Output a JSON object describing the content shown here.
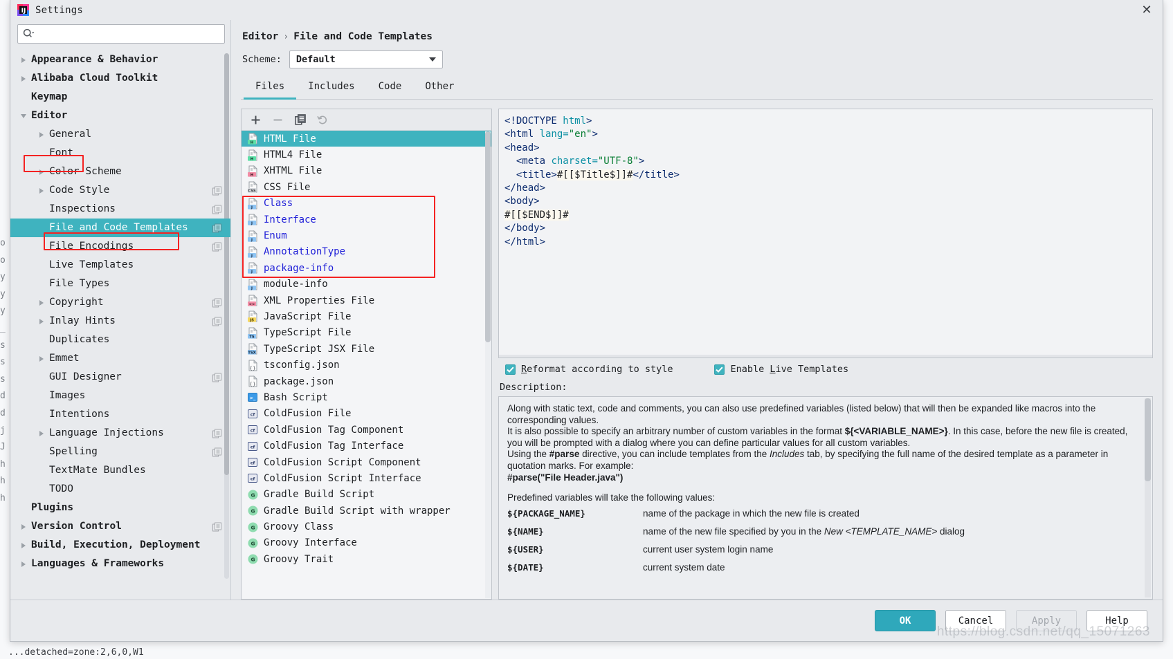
{
  "window": {
    "title": "Settings",
    "close_label": "✕",
    "app_icon": "intellij-idea-icon"
  },
  "search": {
    "placeholder": "",
    "value": "",
    "icon": "search-icon"
  },
  "sidebar": {
    "items": [
      {
        "label": "Appearance & Behavior",
        "indent": 0,
        "arrow": "right",
        "bold": true,
        "badge": false,
        "selected": false
      },
      {
        "label": "Alibaba Cloud Toolkit",
        "indent": 0,
        "arrow": "right",
        "bold": true,
        "badge": false,
        "selected": false
      },
      {
        "label": "Keymap",
        "indent": 0,
        "arrow": "none",
        "bold": true,
        "badge": false,
        "selected": false
      },
      {
        "label": "Editor",
        "indent": 0,
        "arrow": "down",
        "bold": true,
        "badge": false,
        "selected": false
      },
      {
        "label": "General",
        "indent": 1,
        "arrow": "right",
        "bold": false,
        "badge": false,
        "selected": false
      },
      {
        "label": "Font",
        "indent": 1,
        "arrow": "none",
        "bold": false,
        "badge": false,
        "selected": false
      },
      {
        "label": "Color Scheme",
        "indent": 1,
        "arrow": "right",
        "bold": false,
        "badge": false,
        "selected": false
      },
      {
        "label": "Code Style",
        "indent": 1,
        "arrow": "right",
        "bold": false,
        "badge": true,
        "selected": false
      },
      {
        "label": "Inspections",
        "indent": 1,
        "arrow": "none",
        "bold": false,
        "badge": true,
        "selected": false
      },
      {
        "label": "File and Code Templates",
        "indent": 1,
        "arrow": "none",
        "bold": false,
        "badge": true,
        "selected": true
      },
      {
        "label": "File Encodings",
        "indent": 1,
        "arrow": "none",
        "bold": false,
        "badge": true,
        "selected": false
      },
      {
        "label": "Live Templates",
        "indent": 1,
        "arrow": "none",
        "bold": false,
        "badge": false,
        "selected": false
      },
      {
        "label": "File Types",
        "indent": 1,
        "arrow": "none",
        "bold": false,
        "badge": false,
        "selected": false
      },
      {
        "label": "Copyright",
        "indent": 1,
        "arrow": "right",
        "bold": false,
        "badge": true,
        "selected": false
      },
      {
        "label": "Inlay Hints",
        "indent": 1,
        "arrow": "right",
        "bold": false,
        "badge": true,
        "selected": false
      },
      {
        "label": "Duplicates",
        "indent": 1,
        "arrow": "none",
        "bold": false,
        "badge": false,
        "selected": false
      },
      {
        "label": "Emmet",
        "indent": 1,
        "arrow": "right",
        "bold": false,
        "badge": false,
        "selected": false
      },
      {
        "label": "GUI Designer",
        "indent": 1,
        "arrow": "none",
        "bold": false,
        "badge": true,
        "selected": false
      },
      {
        "label": "Images",
        "indent": 1,
        "arrow": "none",
        "bold": false,
        "badge": false,
        "selected": false
      },
      {
        "label": "Intentions",
        "indent": 1,
        "arrow": "none",
        "bold": false,
        "badge": false,
        "selected": false
      },
      {
        "label": "Language Injections",
        "indent": 1,
        "arrow": "right",
        "bold": false,
        "badge": true,
        "selected": false
      },
      {
        "label": "Spelling",
        "indent": 1,
        "arrow": "none",
        "bold": false,
        "badge": true,
        "selected": false
      },
      {
        "label": "TextMate Bundles",
        "indent": 1,
        "arrow": "none",
        "bold": false,
        "badge": false,
        "selected": false
      },
      {
        "label": "TODO",
        "indent": 1,
        "arrow": "none",
        "bold": false,
        "badge": false,
        "selected": false
      },
      {
        "label": "Plugins",
        "indent": 0,
        "arrow": "none",
        "bold": true,
        "badge": false,
        "selected": false
      },
      {
        "label": "Version Control",
        "indent": 0,
        "arrow": "right",
        "bold": true,
        "badge": true,
        "selected": false
      },
      {
        "label": "Build, Execution, Deployment",
        "indent": 0,
        "arrow": "right",
        "bold": true,
        "badge": false,
        "selected": false
      },
      {
        "label": "Languages & Frameworks",
        "indent": 0,
        "arrow": "right",
        "bold": true,
        "badge": false,
        "selected": false
      }
    ]
  },
  "breadcrumb": {
    "parent": "Editor",
    "separator": "›",
    "current": "File and Code Templates"
  },
  "scheme": {
    "label": "Scheme:",
    "value": "Default"
  },
  "tabs": [
    {
      "label": "Files",
      "active": true
    },
    {
      "label": "Includes",
      "active": false
    },
    {
      "label": "Code",
      "active": false
    },
    {
      "label": "Other",
      "active": false
    }
  ],
  "list_toolbar": [
    {
      "name": "add-template-button",
      "glyph": "plus",
      "enabled": true
    },
    {
      "name": "remove-template-button",
      "glyph": "minus",
      "enabled": false
    },
    {
      "name": "copy-template-button",
      "glyph": "copy",
      "enabled": true
    },
    {
      "name": "reset-template-button",
      "glyph": "undo",
      "enabled": false
    }
  ],
  "file_templates": [
    {
      "label": "HTML File",
      "icon": "html-file-icon",
      "selected": true,
      "java": false
    },
    {
      "label": "HTML4 File",
      "icon": "html-file-icon",
      "selected": false,
      "java": false
    },
    {
      "label": "XHTML File",
      "icon": "xhtml-file-icon",
      "selected": false,
      "java": false
    },
    {
      "label": "CSS File",
      "icon": "css-file-icon",
      "selected": false,
      "java": false
    },
    {
      "label": "Class",
      "icon": "java-file-icon",
      "selected": false,
      "java": true
    },
    {
      "label": "Interface",
      "icon": "java-file-icon",
      "selected": false,
      "java": true
    },
    {
      "label": "Enum",
      "icon": "java-file-icon",
      "selected": false,
      "java": true
    },
    {
      "label": "AnnotationType",
      "icon": "java-file-icon",
      "selected": false,
      "java": true
    },
    {
      "label": "package-info",
      "icon": "java-file-icon",
      "selected": false,
      "java": true
    },
    {
      "label": "module-info",
      "icon": "java-file-icon",
      "selected": false,
      "java": false
    },
    {
      "label": "XML Properties File",
      "icon": "xml-file-icon",
      "selected": false,
      "java": false
    },
    {
      "label": "JavaScript File",
      "icon": "javascript-file-icon",
      "selected": false,
      "java": false
    },
    {
      "label": "TypeScript File",
      "icon": "typescript-file-icon",
      "selected": false,
      "java": false
    },
    {
      "label": "TypeScript JSX File",
      "icon": "tsx-file-icon",
      "selected": false,
      "java": false
    },
    {
      "label": "tsconfig.json",
      "icon": "json-file-icon",
      "selected": false,
      "java": false
    },
    {
      "label": "package.json",
      "icon": "json-file-icon",
      "selected": false,
      "java": false
    },
    {
      "label": "Bash Script",
      "icon": "bash-script-icon",
      "selected": false,
      "java": false
    },
    {
      "label": "ColdFusion File",
      "icon": "coldfusion-icon",
      "selected": false,
      "java": false
    },
    {
      "label": "ColdFusion Tag Component",
      "icon": "coldfusion-icon",
      "selected": false,
      "java": false
    },
    {
      "label": "ColdFusion Tag Interface",
      "icon": "coldfusion-icon",
      "selected": false,
      "java": false
    },
    {
      "label": "ColdFusion Script Component",
      "icon": "coldfusion-icon",
      "selected": false,
      "java": false
    },
    {
      "label": "ColdFusion Script Interface",
      "icon": "coldfusion-icon",
      "selected": false,
      "java": false
    },
    {
      "label": "Gradle Build Script",
      "icon": "groovy-icon",
      "selected": false,
      "java": false
    },
    {
      "label": "Gradle Build Script with wrapper",
      "icon": "groovy-icon",
      "selected": false,
      "java": false
    },
    {
      "label": "Groovy Class",
      "icon": "groovy-icon",
      "selected": false,
      "java": false
    },
    {
      "label": "Groovy Interface",
      "icon": "groovy-icon",
      "selected": false,
      "java": false
    },
    {
      "label": "Groovy Trait",
      "icon": "groovy-icon",
      "selected": false,
      "java": false
    }
  ],
  "editor": {
    "lines": [
      [
        {
          "t": "<!DOCTYPE ",
          "c": "tag"
        },
        {
          "t": "html",
          "c": "attr"
        },
        {
          "t": ">",
          "c": "tag"
        }
      ],
      [
        {
          "t": "<html ",
          "c": "tag"
        },
        {
          "t": "lang=",
          "c": "attr"
        },
        {
          "t": "\"en\"",
          "c": "val"
        },
        {
          "t": ">",
          "c": "tag"
        }
      ],
      [
        {
          "t": "<head>",
          "c": "tag"
        }
      ],
      [
        {
          "t": "  <meta ",
          "c": "tag"
        },
        {
          "t": "charset=",
          "c": "attr"
        },
        {
          "t": "\"UTF-8\"",
          "c": "val"
        },
        {
          "t": ">",
          "c": "tag"
        }
      ],
      [
        {
          "t": "  <title>",
          "c": "tag"
        },
        {
          "t": "#[[$Title$]]#",
          "c": "var"
        },
        {
          "t": "</title>",
          "c": "tag"
        }
      ],
      [
        {
          "t": "</head>",
          "c": "tag"
        }
      ],
      [
        {
          "t": "<body>",
          "c": "tag"
        }
      ],
      [
        {
          "t": "#[[$END$]]#",
          "c": "var"
        }
      ],
      [
        {
          "t": "</body>",
          "c": "tag"
        }
      ],
      [
        {
          "t": "</html>",
          "c": "tag"
        }
      ]
    ]
  },
  "options": {
    "reformat": {
      "label_pre": "",
      "label_accel": "R",
      "label_post": "eformat according to style",
      "checked": true
    },
    "live_templates": {
      "label_pre": "Enable ",
      "label_accel": "L",
      "label_post": "ive Templates",
      "checked": true
    }
  },
  "description": {
    "label": "Description:",
    "paragraphs": [
      "Along with static text, code and comments, you can also use predefined variables (listed below) that will then be expanded like macros into the corresponding values.",
      "It is also possible to specify an arbitrary number of custom variables in the format ${<VARIABLE_NAME>}. In this case, before the new file is created, you will be prompted with a dialog where you can define particular values for all custom variables.",
      "Using the #parse directive, you can include templates from the Includes tab, by specifying the full name of the desired template as a parameter in quotation marks. For example:",
      "#parse(\"File Header.java\")",
      "Predefined variables will take the following values:"
    ],
    "variables": [
      {
        "name": "${PACKAGE_NAME}",
        "desc": "name of the package in which the new file is created"
      },
      {
        "name": "${NAME}",
        "desc": "name of the new file specified by you in the New <TEMPLATE_NAME> dialog"
      },
      {
        "name": "${USER}",
        "desc": "current user system login name"
      },
      {
        "name": "${DATE}",
        "desc": "current system date"
      }
    ]
  },
  "footer": {
    "ok": "OK",
    "cancel": "Cancel",
    "apply": "Apply",
    "help": "Help",
    "watermark": "https://blog.csdn.net/qq_15071263"
  },
  "background": {
    "gutter": "o\no\ny\ny\ny\n_\ns\ns\ns\nd\nd\nj\nJ\nh\nh\nh",
    "bottom": "...detached=zone:2,6,0,W1"
  },
  "colors": {
    "accent": "#3fb3bf",
    "primary_button": "#2fa8bb",
    "annotation": "#f42222",
    "java_text": "#2020d8",
    "dialog_bg": "#e8eaed"
  }
}
